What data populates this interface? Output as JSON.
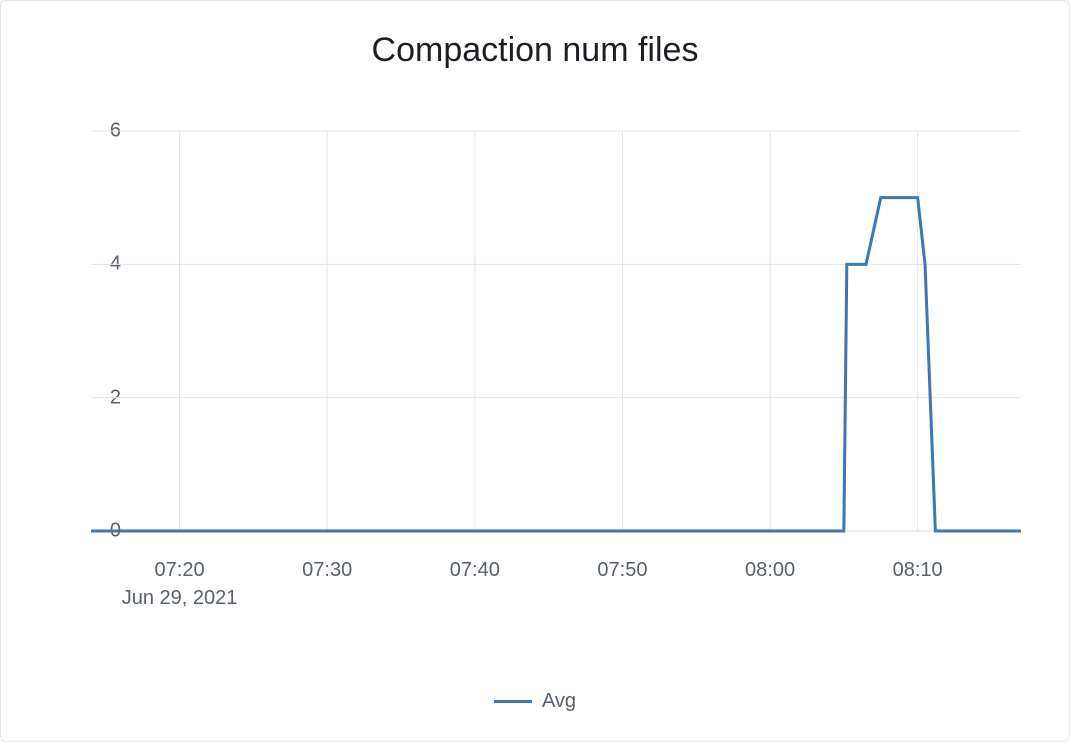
{
  "chart_data": {
    "type": "line",
    "title": "Compaction num files",
    "xlabel": "",
    "ylabel": "",
    "ylim": [
      0,
      6
    ],
    "y_ticks": [
      0,
      2,
      4,
      6
    ],
    "x_range_minutes": [
      14,
      77
    ],
    "x_ticks": [
      {
        "minute": 20,
        "label": "07:20"
      },
      {
        "minute": 30,
        "label": "07:30"
      },
      {
        "minute": 40,
        "label": "07:40"
      },
      {
        "minute": 50,
        "label": "07:50"
      },
      {
        "minute": 60,
        "label": "08:00"
      },
      {
        "minute": 70,
        "label": "08:10"
      }
    ],
    "x_date_label": "Jun 29, 2021",
    "series": [
      {
        "name": "Avg",
        "color": "#3c78b5",
        "points": [
          {
            "minute": 14,
            "value": 0
          },
          {
            "minute": 65,
            "value": 0
          },
          {
            "minute": 65.2,
            "value": 4
          },
          {
            "minute": 66.5,
            "value": 4
          },
          {
            "minute": 67.5,
            "value": 5
          },
          {
            "minute": 70,
            "value": 5
          },
          {
            "minute": 70.5,
            "value": 4
          },
          {
            "minute": 71.2,
            "value": 0
          },
          {
            "minute": 77,
            "value": 0
          }
        ]
      }
    ],
    "legend": {
      "items": [
        "Avg"
      ]
    }
  }
}
